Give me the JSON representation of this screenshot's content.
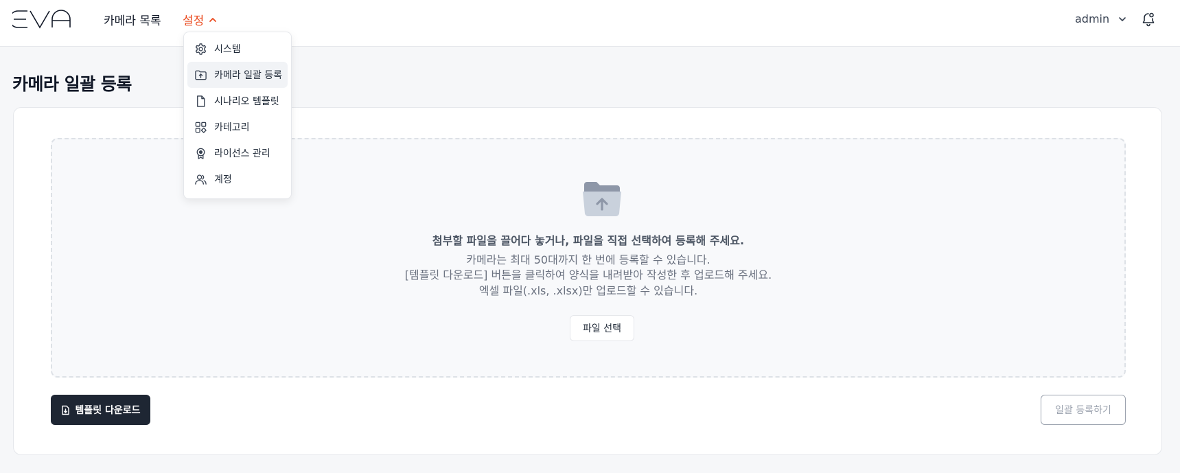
{
  "header": {
    "logo_text": "EVA",
    "nav": {
      "cameras": "카메라 목록",
      "settings": "설정"
    },
    "user": "admin"
  },
  "settings_menu": {
    "items": [
      {
        "label": "시스템",
        "icon": "gear-icon"
      },
      {
        "label": "카메라 일괄 등록",
        "icon": "folder-upload-icon",
        "active": true
      },
      {
        "label": "시나리오 템플릿",
        "icon": "file-icon"
      },
      {
        "label": "카테고리",
        "icon": "category-grid-icon"
      },
      {
        "label": "라이선스 관리",
        "icon": "badge-icon"
      },
      {
        "label": "계정",
        "icon": "users-icon"
      }
    ]
  },
  "page": {
    "title": "카메라 일괄 등록"
  },
  "dropzone": {
    "main": "첨부할 파일을 끌어다 놓거나, 파일을 직접 선택하여 등록해 주세요.",
    "line1": "카메라는 최대 50대까지 한 번에 등록할 수 있습니다.",
    "line2": "[템플릿 다운로드] 버튼을 클릭하여 양식을 내려받아 작성한 후 업로드해 주세요.",
    "line3": "엑셀 파일(.xls, .xlsx)만 업로드할 수 있습니다.",
    "select_button": "파일 선택"
  },
  "actions": {
    "template_download": "템플릿 다운로드",
    "bulk_register": "일괄 등록하기"
  },
  "colors": {
    "accent": "#ea4a1e",
    "dark_button": "#1e2633",
    "icon_gray": "#9aa3b2"
  }
}
